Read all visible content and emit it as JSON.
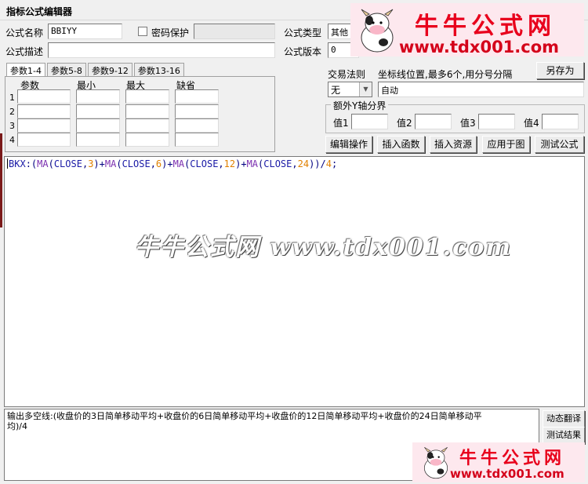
{
  "window": {
    "title": "指标公式编辑器"
  },
  "form": {
    "name_label": "公式名称",
    "name_value": "BBIYY",
    "password_label": "密码保护",
    "desc_label": "公式描述",
    "desc_value": "",
    "type_label": "公式类型",
    "type_value": "其他",
    "version_label": "公式版本",
    "version_value": "0"
  },
  "tabs": [
    "参数1-4",
    "参数5-8",
    "参数9-12",
    "参数13-16"
  ],
  "params": {
    "headers": [
      "参数",
      "最小",
      "最大",
      "缺省"
    ],
    "rows": [
      "1",
      "2",
      "3",
      "4"
    ]
  },
  "trade": {
    "label": "交易法则",
    "value": "无"
  },
  "axis": {
    "label": "坐标线位置,最多6个,用分号分隔",
    "value": "自动"
  },
  "yaxis": {
    "legend": "额外Y轴分界",
    "labels": [
      "值1",
      "值2",
      "值3",
      "值4"
    ]
  },
  "buttons": {
    "save_as": "另存为",
    "edit_ops": "编辑操作",
    "insert_func": "插入函数",
    "insert_res": "插入资源",
    "apply_chart": "应用于图",
    "test": "测试公式",
    "dyn_translate": "动态翻译",
    "test_result": "测试结果"
  },
  "code": {
    "var": "BKX",
    "assign": ":(",
    "fn": "MA",
    "arg": "CLOSE",
    "n1": "3",
    "n2": "6",
    "n3": "12",
    "n4": "24",
    "div": "4"
  },
  "editor_watermark": "牛牛公式网 www.tdx001.com",
  "output_text": "输出多空线:(收盘价的3日简单移动平均+收盘价的6日简单移动平均+收盘价的12日简单移动平均+收盘价的24日简单移动平\n均)/4",
  "logo": {
    "brand": "牛牛公式网",
    "url": "www.tdx001.com",
    "brand_color": "#e8001c"
  }
}
